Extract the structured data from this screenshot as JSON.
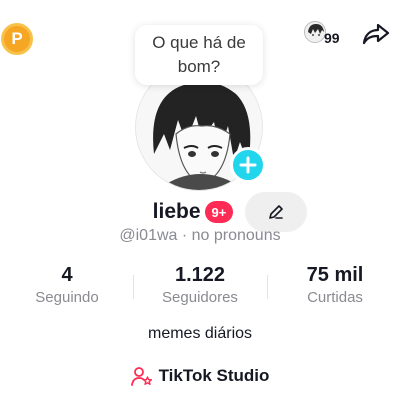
{
  "coin": {
    "label": "P",
    "color": "#f5a623"
  },
  "friends": {
    "count": "99",
    "icon": "friend-avatar"
  },
  "share": {
    "icon": "share-arrow-icon"
  },
  "bubble": {
    "text": "O que há de bom?"
  },
  "avatar": {
    "add_icon": "plus-icon",
    "add_color": "#20d5ec"
  },
  "profile": {
    "username": "liebe",
    "notification_badge": "9+",
    "handle": "@i01wa · no pronouns",
    "bio": "memes diários",
    "edit_icon": "pencil-icon"
  },
  "stats": [
    {
      "value": "4",
      "label": "Seguindo"
    },
    {
      "value": "1.122",
      "label": "Seguidores"
    },
    {
      "value": "75 mil",
      "label": "Curtidas"
    }
  ],
  "studio": {
    "label": "TikTok Studio",
    "icon": "person-star-icon",
    "icon_color": "#fe2c55"
  },
  "colors": {
    "accent": "#fe2c55",
    "text": "#161823",
    "muted": "#8a8b91"
  }
}
